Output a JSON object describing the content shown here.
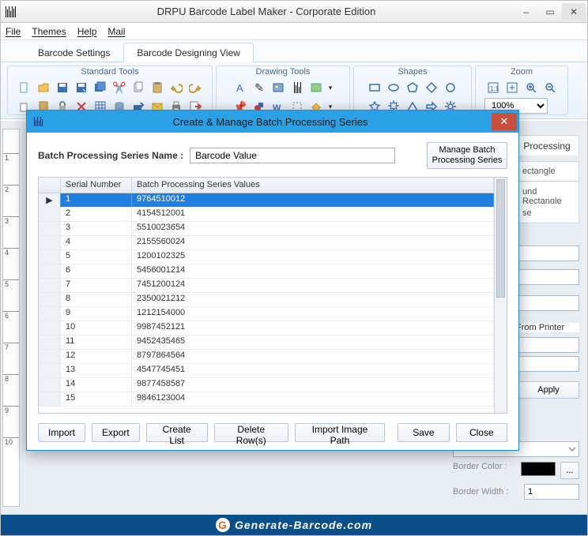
{
  "window": {
    "title": "DRPU Barcode Label Maker - Corporate Edition",
    "min_label": "–",
    "max_label": "▭",
    "close_label": "✕"
  },
  "menu": {
    "file": "File",
    "themes": "Themes",
    "help": "Help",
    "mail": "Mail"
  },
  "view_tabs": {
    "settings": "Barcode Settings",
    "designing": "Barcode Designing View"
  },
  "ribbon_groups": {
    "standard": "Standard Tools",
    "drawing": "Drawing Tools",
    "shapes": "Shapes",
    "zoom": "Zoom",
    "zoom_value": "100%"
  },
  "right_panel": {
    "tab": "Processing",
    "opt_rect": "ectangle",
    "opt_round": "und Rectangle",
    "opt_se": "se",
    "from_printer": "From Printer",
    "apply": "Apply",
    "border_color": "Border Color :",
    "border_width_label": "Border Width :",
    "border_width_value": "1",
    "ellipsis": "..."
  },
  "dialog": {
    "title": "Create & Manage Batch Processing Series",
    "name_label": "Batch Processing Series Name :",
    "name_value": "Barcode Value",
    "manage_btn": "Manage  Batch\nProcessing Series",
    "col_serial": "Serial Number",
    "col_values": "Batch Processing Series Values",
    "rows": [
      {
        "n": "1",
        "v": "9764510012"
      },
      {
        "n": "2",
        "v": "4154512001"
      },
      {
        "n": "3",
        "v": "5510023654"
      },
      {
        "n": "4",
        "v": "2155560024"
      },
      {
        "n": "5",
        "v": "1200102325"
      },
      {
        "n": "6",
        "v": "5456001214"
      },
      {
        "n": "7",
        "v": "7451200124"
      },
      {
        "n": "8",
        "v": "2350021212"
      },
      {
        "n": "9",
        "v": "1212154000"
      },
      {
        "n": "10",
        "v": "9987452121"
      },
      {
        "n": "11",
        "v": "9452435465"
      },
      {
        "n": "12",
        "v": "8797864564"
      },
      {
        "n": "13",
        "v": "4547745451"
      },
      {
        "n": "14",
        "v": "9877458587"
      },
      {
        "n": "15",
        "v": "9846123004"
      }
    ],
    "buttons": {
      "import": "Import",
      "export": "Export",
      "create_list": "Create List",
      "delete_rows": "Delete Row(s)",
      "import_image": "Import Image Path",
      "save": "Save",
      "close": "Close"
    }
  },
  "footer": {
    "brand": "Generate-Barcode.com",
    "g": "G"
  },
  "ruler_marks": [
    "1",
    "2",
    "3",
    "4",
    "5",
    "6",
    "7",
    "8",
    "9",
    "10"
  ]
}
